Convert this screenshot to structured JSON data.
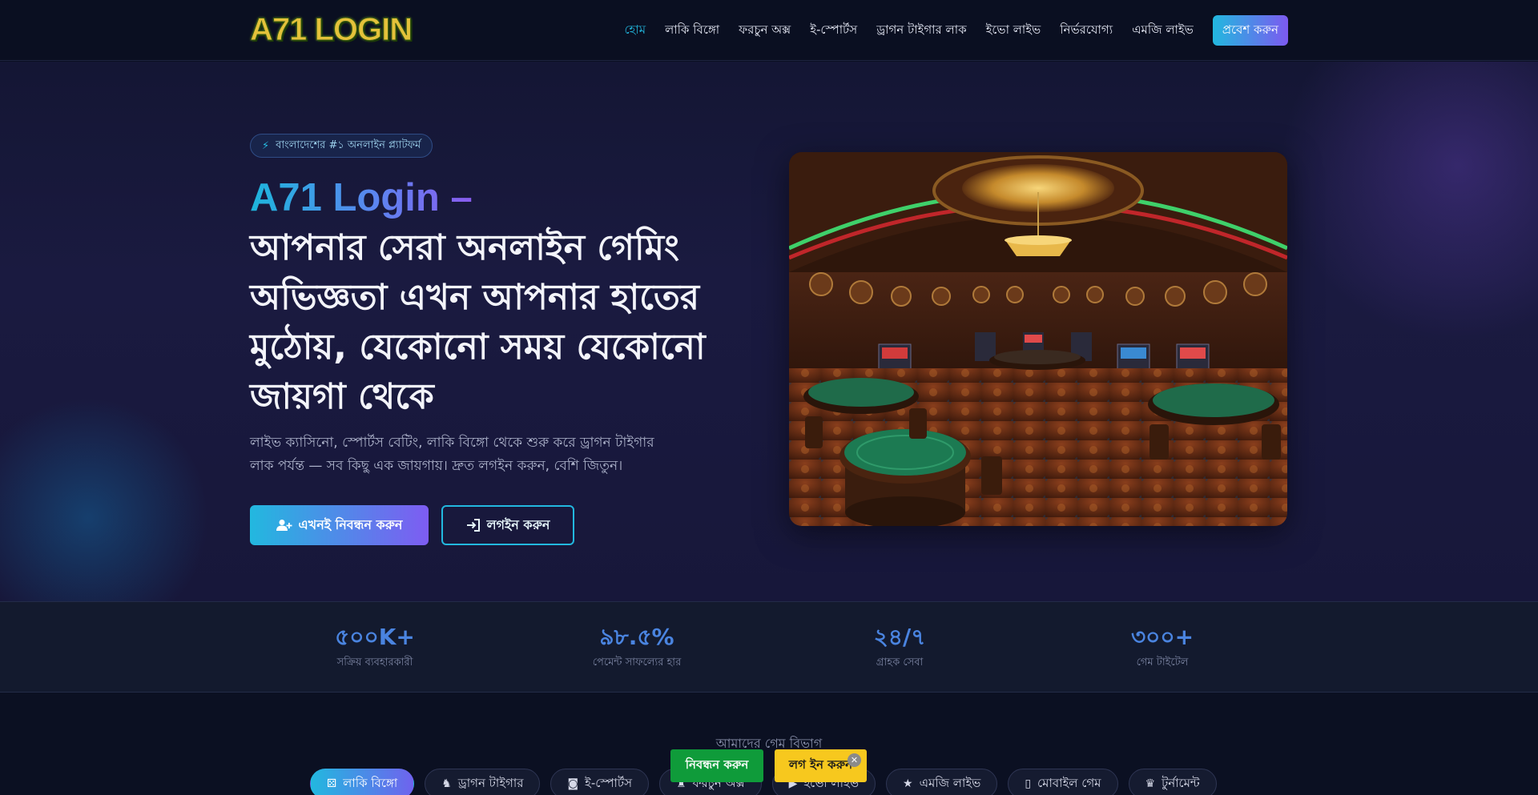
{
  "header": {
    "logo_text": "A71 LOGIN",
    "nav": [
      {
        "label": "হোম",
        "active": true
      },
      {
        "label": "লাকি বিঙ্গো"
      },
      {
        "label": "ফরচুন অক্স"
      },
      {
        "label": "ই-স্পোর্টস"
      },
      {
        "label": "ড্রাগন টাইগার লাক"
      },
      {
        "label": "ইভো লাইভ"
      },
      {
        "label": "নির্ভরযোগ্য"
      },
      {
        "label": "এমজি লাইভ"
      }
    ],
    "enter_button": "প্রবেশ করুন"
  },
  "hero": {
    "badge": "বাংলাদেশের #১ অনলাইন প্ল্যাটফর্ম",
    "title_highlight": "A71 Login –",
    "title_main": "আপনার সেরা অনলাইন গেমিং অভিজ্ঞতা এখন আপনার হাতের মুঠোয়, যেকোনো সময় যেকোনো জায়গা থেকে",
    "description": "লাইভ ক্যাসিনো, স্পোর্টস বেটিং, লাকি বিঙ্গো থেকে শুরু করে ড্রাগন টাইগার লাক পর্যন্ত — সব কিছু এক জায়গায়। দ্রুত লগইন করুন, বেশি জিতুন।",
    "register_button": "এখনই নিবন্ধন করুন",
    "login_button": "লগইন করুন"
  },
  "stats": [
    {
      "value": "৫০০K+",
      "label": "সক্রিয় ব্যবহারকারী"
    },
    {
      "value": "৯৮.৫%",
      "label": "পেমেন্ট সাফল্যের হার"
    },
    {
      "value": "২৪/৭",
      "label": "গ্রাহক সেবা"
    },
    {
      "value": "৩০০+",
      "label": "গেম টাইটেল"
    }
  ],
  "categories": {
    "section_label": "আমাদের গেম বিভাগ",
    "items": [
      {
        "label": "লাকি বিঙ্গো",
        "icon": "dice-icon",
        "active": true
      },
      {
        "label": "ড্রাগন টাইগার",
        "icon": "dragon-icon"
      },
      {
        "label": "ই-স্পোর্টস",
        "icon": "gamepad-icon"
      },
      {
        "label": "ফরচুন অক্স",
        "icon": "ox-icon"
      },
      {
        "label": "ইভো লাইভ",
        "icon": "video-icon"
      },
      {
        "label": "এমজি লাইভ",
        "icon": "star-icon"
      },
      {
        "label": "মোবাইল গেম",
        "icon": "mobile-icon"
      },
      {
        "label": "টুর্নামেন্ট",
        "icon": "trophy-icon"
      }
    ]
  },
  "floating_cta": {
    "register": "নিবন্ধন করুন",
    "login": "লগ ইন করুন",
    "close": "✕"
  },
  "colors": {
    "accent_cyan": "#22b8df",
    "accent_purple": "#7c5af0",
    "stat_blue": "#4a84e0",
    "cta_green": "#0f9b3a",
    "cta_yellow": "#f7c81e"
  }
}
